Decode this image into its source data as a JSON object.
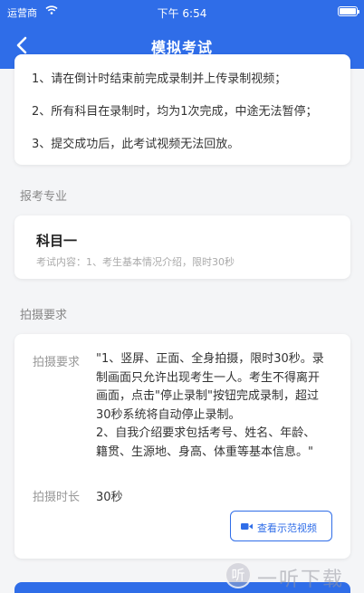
{
  "status_bar": {
    "carrier": "运营商",
    "time": "下午 6:54"
  },
  "nav": {
    "title": "模拟考试"
  },
  "notes": [
    "1、请在倒计时结束前完成录制并上传录制视频；",
    "2、所有科目在录制时，均为1次完成，中途无法暂停；",
    "3、提交成功后，此考试视频无法回放。"
  ],
  "major_section": {
    "label": "报考专业"
  },
  "subject": {
    "name": "科目一",
    "description": "考试内容：1、考生基本情况介绍，限时30秒"
  },
  "shooting_section": {
    "label": "拍摄要求"
  },
  "requirements": {
    "label": "拍摄要求",
    "lines": [
      "\"1、竖屏、正面、全身拍摄，限时30秒。录",
      "制画面只允许出现考生一人。考生不得离开",
      "画面，点击\"停止录制\"按钮完成录制，超过",
      "30秒系统将自动停止录制。",
      "2、自我介绍要求包括考号、姓名、年龄、",
      "籍贯、生源地、身高、体重等基本信息。\""
    ],
    "duration_label": "拍摄时长",
    "duration_value": "30秒",
    "demo_button": "查看示范视频"
  },
  "watermark": {
    "logo": "听",
    "text": "一听下载"
  },
  "colors": {
    "primary": "#2f6de8",
    "background": "#f4f5f7"
  }
}
